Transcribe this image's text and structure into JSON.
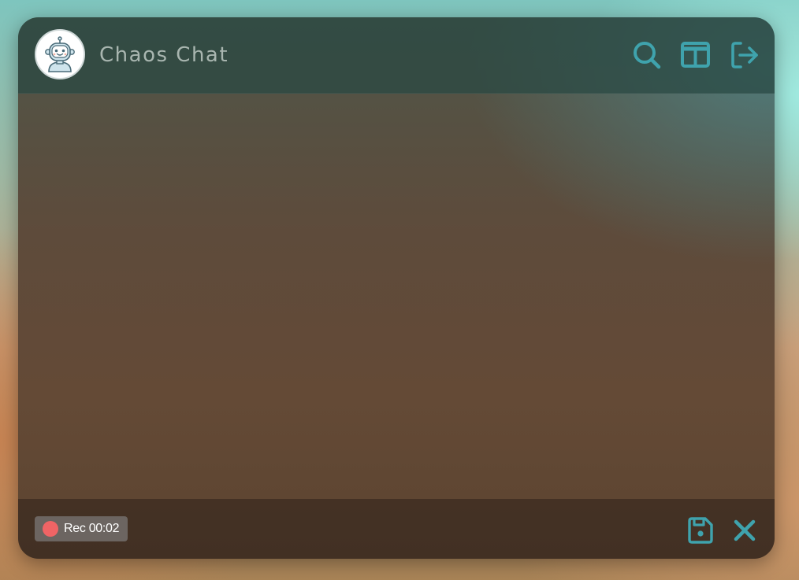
{
  "app": {
    "title": "Chaos Chat",
    "avatar_icon": "robot-icon",
    "accent_color": "#3fa3ad"
  },
  "header": {
    "actions": [
      {
        "name": "search",
        "icon": "search-icon"
      },
      {
        "name": "layout",
        "icon": "columns-icon"
      },
      {
        "name": "logout",
        "icon": "logout-icon"
      }
    ]
  },
  "footer": {
    "recording": {
      "label": "Rec 00:02",
      "indicator_color": "#f06465"
    },
    "actions": [
      {
        "name": "save",
        "icon": "save-icon"
      },
      {
        "name": "close",
        "icon": "close-icon"
      }
    ]
  }
}
